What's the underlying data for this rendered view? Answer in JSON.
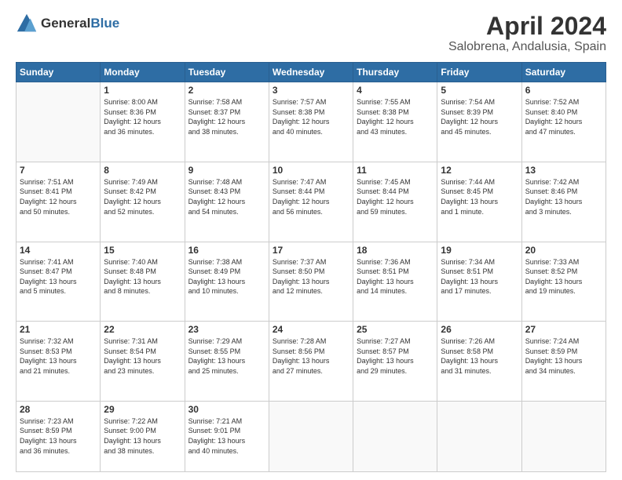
{
  "header": {
    "logo_line1": "General",
    "logo_line2": "Blue",
    "title": "April 2024",
    "subtitle": "Salobrena, Andalusia, Spain"
  },
  "days_of_week": [
    "Sunday",
    "Monday",
    "Tuesday",
    "Wednesday",
    "Thursday",
    "Friday",
    "Saturday"
  ],
  "weeks": [
    [
      {
        "day": "",
        "info": ""
      },
      {
        "day": "1",
        "info": "Sunrise: 8:00 AM\nSunset: 8:36 PM\nDaylight: 12 hours\nand 36 minutes."
      },
      {
        "day": "2",
        "info": "Sunrise: 7:58 AM\nSunset: 8:37 PM\nDaylight: 12 hours\nand 38 minutes."
      },
      {
        "day": "3",
        "info": "Sunrise: 7:57 AM\nSunset: 8:38 PM\nDaylight: 12 hours\nand 40 minutes."
      },
      {
        "day": "4",
        "info": "Sunrise: 7:55 AM\nSunset: 8:38 PM\nDaylight: 12 hours\nand 43 minutes."
      },
      {
        "day": "5",
        "info": "Sunrise: 7:54 AM\nSunset: 8:39 PM\nDaylight: 12 hours\nand 45 minutes."
      },
      {
        "day": "6",
        "info": "Sunrise: 7:52 AM\nSunset: 8:40 PM\nDaylight: 12 hours\nand 47 minutes."
      }
    ],
    [
      {
        "day": "7",
        "info": "Sunrise: 7:51 AM\nSunset: 8:41 PM\nDaylight: 12 hours\nand 50 minutes."
      },
      {
        "day": "8",
        "info": "Sunrise: 7:49 AM\nSunset: 8:42 PM\nDaylight: 12 hours\nand 52 minutes."
      },
      {
        "day": "9",
        "info": "Sunrise: 7:48 AM\nSunset: 8:43 PM\nDaylight: 12 hours\nand 54 minutes."
      },
      {
        "day": "10",
        "info": "Sunrise: 7:47 AM\nSunset: 8:44 PM\nDaylight: 12 hours\nand 56 minutes."
      },
      {
        "day": "11",
        "info": "Sunrise: 7:45 AM\nSunset: 8:44 PM\nDaylight: 12 hours\nand 59 minutes."
      },
      {
        "day": "12",
        "info": "Sunrise: 7:44 AM\nSunset: 8:45 PM\nDaylight: 13 hours\nand 1 minute."
      },
      {
        "day": "13",
        "info": "Sunrise: 7:42 AM\nSunset: 8:46 PM\nDaylight: 13 hours\nand 3 minutes."
      }
    ],
    [
      {
        "day": "14",
        "info": "Sunrise: 7:41 AM\nSunset: 8:47 PM\nDaylight: 13 hours\nand 5 minutes."
      },
      {
        "day": "15",
        "info": "Sunrise: 7:40 AM\nSunset: 8:48 PM\nDaylight: 13 hours\nand 8 minutes."
      },
      {
        "day": "16",
        "info": "Sunrise: 7:38 AM\nSunset: 8:49 PM\nDaylight: 13 hours\nand 10 minutes."
      },
      {
        "day": "17",
        "info": "Sunrise: 7:37 AM\nSunset: 8:50 PM\nDaylight: 13 hours\nand 12 minutes."
      },
      {
        "day": "18",
        "info": "Sunrise: 7:36 AM\nSunset: 8:51 PM\nDaylight: 13 hours\nand 14 minutes."
      },
      {
        "day": "19",
        "info": "Sunrise: 7:34 AM\nSunset: 8:51 PM\nDaylight: 13 hours\nand 17 minutes."
      },
      {
        "day": "20",
        "info": "Sunrise: 7:33 AM\nSunset: 8:52 PM\nDaylight: 13 hours\nand 19 minutes."
      }
    ],
    [
      {
        "day": "21",
        "info": "Sunrise: 7:32 AM\nSunset: 8:53 PM\nDaylight: 13 hours\nand 21 minutes."
      },
      {
        "day": "22",
        "info": "Sunrise: 7:31 AM\nSunset: 8:54 PM\nDaylight: 13 hours\nand 23 minutes."
      },
      {
        "day": "23",
        "info": "Sunrise: 7:29 AM\nSunset: 8:55 PM\nDaylight: 13 hours\nand 25 minutes."
      },
      {
        "day": "24",
        "info": "Sunrise: 7:28 AM\nSunset: 8:56 PM\nDaylight: 13 hours\nand 27 minutes."
      },
      {
        "day": "25",
        "info": "Sunrise: 7:27 AM\nSunset: 8:57 PM\nDaylight: 13 hours\nand 29 minutes."
      },
      {
        "day": "26",
        "info": "Sunrise: 7:26 AM\nSunset: 8:58 PM\nDaylight: 13 hours\nand 31 minutes."
      },
      {
        "day": "27",
        "info": "Sunrise: 7:24 AM\nSunset: 8:59 PM\nDaylight: 13 hours\nand 34 minutes."
      }
    ],
    [
      {
        "day": "28",
        "info": "Sunrise: 7:23 AM\nSunset: 8:59 PM\nDaylight: 13 hours\nand 36 minutes."
      },
      {
        "day": "29",
        "info": "Sunrise: 7:22 AM\nSunset: 9:00 PM\nDaylight: 13 hours\nand 38 minutes."
      },
      {
        "day": "30",
        "info": "Sunrise: 7:21 AM\nSunset: 9:01 PM\nDaylight: 13 hours\nand 40 minutes."
      },
      {
        "day": "",
        "info": ""
      },
      {
        "day": "",
        "info": ""
      },
      {
        "day": "",
        "info": ""
      },
      {
        "day": "",
        "info": ""
      }
    ]
  ]
}
